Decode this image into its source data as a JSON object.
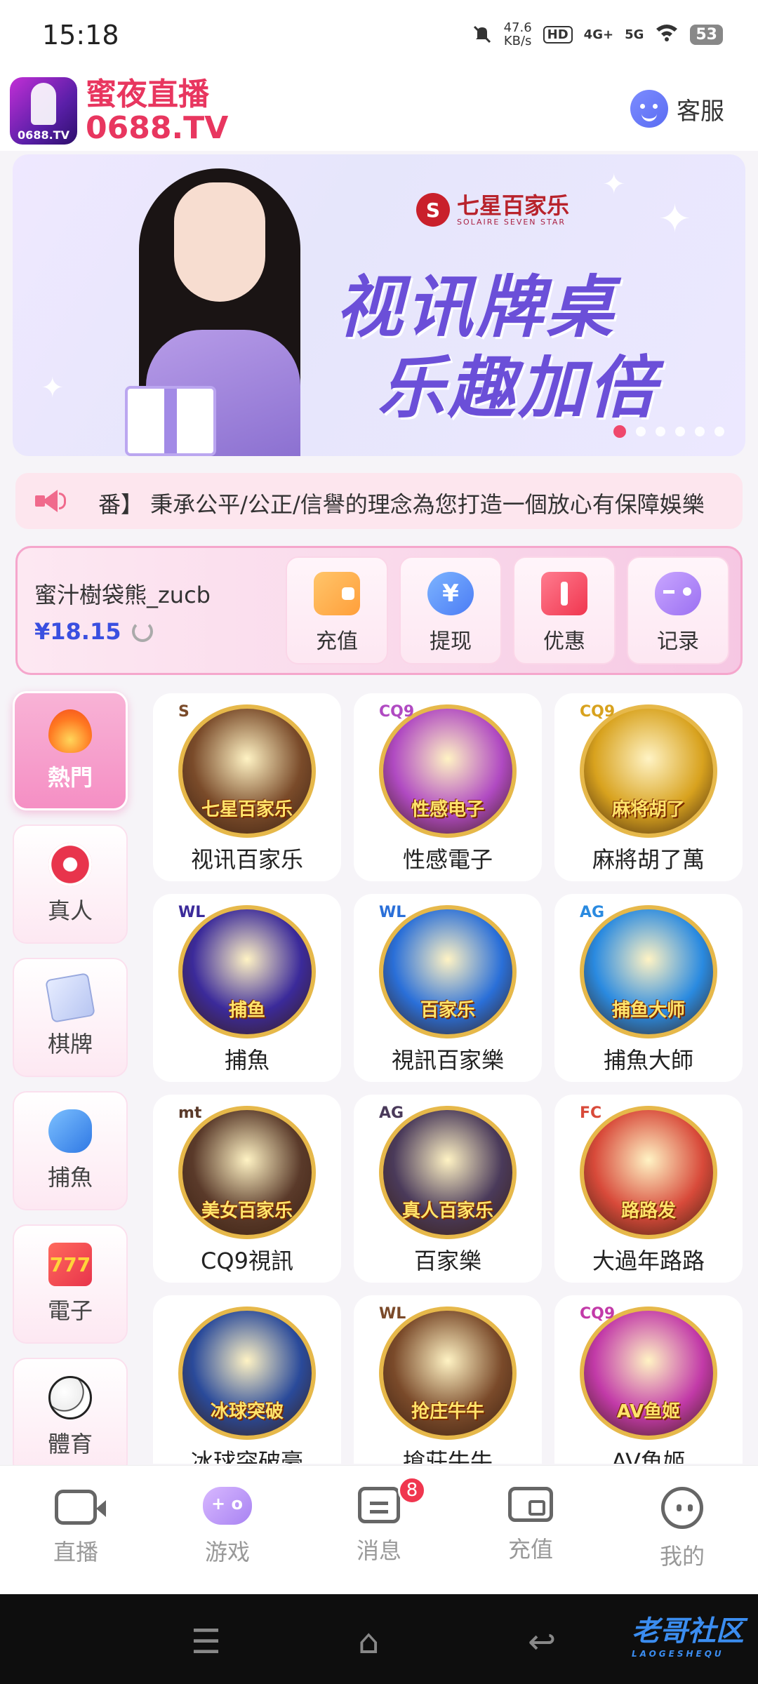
{
  "status": {
    "time": "15:18",
    "speed_value": "47.6",
    "speed_unit": "KB/s",
    "hd": "HD",
    "net1": "4G+",
    "net2": "5G",
    "battery": "53"
  },
  "header": {
    "logo_tag": "0688.TV",
    "title": "蜜夜直播",
    "url": "0688.TV",
    "customer_service": "客服"
  },
  "banner": {
    "brand_badge": "S",
    "brand_name": "七星百家乐",
    "brand_sub": "SOLAIRE SEVEN STAR",
    "line1": "视讯牌桌",
    "line2": "乐趣加倍",
    "slide_count": 6,
    "active_slide": 1
  },
  "marquee": {
    "text": "番】 秉承公平/公正/信譽的理念為您打造一個放心有保障娛樂"
  },
  "account": {
    "username": "蜜汁樹袋熊_zucb",
    "balance": "¥18.15",
    "actions": [
      {
        "label": "充值",
        "icon": "wallet-icon"
      },
      {
        "label": "提现",
        "icon": "yen-coin-icon"
      },
      {
        "label": "优惠",
        "icon": "ticket-icon"
      },
      {
        "label": "记录",
        "icon": "gamepad-icon"
      }
    ]
  },
  "categories": [
    {
      "label": "熱門",
      "icon": "fire-icon",
      "active": true
    },
    {
      "label": "真人",
      "icon": "chip-icon",
      "active": false
    },
    {
      "label": "棋牌",
      "icon": "cards-icon",
      "active": false
    },
    {
      "label": "捕魚",
      "icon": "shark-icon",
      "active": false
    },
    {
      "label": "電子",
      "icon": "slot-777-icon",
      "active": false
    },
    {
      "label": "體育",
      "icon": "soccer-ball-icon",
      "active": false
    }
  ],
  "games": [
    {
      "name": "视讯百家乐",
      "art_title": "七星百家乐",
      "provider": "S",
      "color": "#7a4b2a"
    },
    {
      "name": "性感電子",
      "art_title": "性感电子",
      "provider": "CQ9",
      "color": "#b04ac2"
    },
    {
      "name": "麻將胡了萬",
      "art_title": "麻将胡了",
      "provider": "CQ9",
      "color": "#d8a21e"
    },
    {
      "name": "捕魚",
      "art_title": "捕鱼",
      "provider": "WL",
      "color": "#3b2a9a"
    },
    {
      "name": "視訊百家樂",
      "art_title": "百家乐",
      "provider": "WL",
      "color": "#2a6fd8"
    },
    {
      "name": "捕魚大師",
      "art_title": "捕鱼大师",
      "provider": "AG",
      "color": "#2a8ae0"
    },
    {
      "name": "CQ9視訊",
      "art_title": "美女百家乐",
      "provider": "mt",
      "color": "#5a3a2a"
    },
    {
      "name": "百家樂",
      "art_title": "真人百家乐",
      "provider": "AG",
      "color": "#4a3a5a"
    },
    {
      "name": "大過年路路",
      "art_title": "路路发",
      "provider": "FC",
      "color": "#d84a3a"
    },
    {
      "name": "冰球突破豪",
      "art_title": "冰球突破",
      "provider": "",
      "color": "#2a4a9a"
    },
    {
      "name": "搶莊牛牛",
      "art_title": "抢庄牛牛",
      "provider": "WL",
      "color": "#7a4a2a"
    },
    {
      "name": "AV魚姬",
      "art_title": "AV鱼姬",
      "provider": "CQ9",
      "color": "#c23aa8"
    }
  ],
  "bottom_nav": [
    {
      "label": "直播",
      "icon": "tv-icon"
    },
    {
      "label": "游戏",
      "icon": "gamepad-icon"
    },
    {
      "label": "消息",
      "icon": "message-icon",
      "badge": "8"
    },
    {
      "label": "充值",
      "icon": "wallet-icon"
    },
    {
      "label": "我的",
      "icon": "face-icon"
    }
  ],
  "watermark": {
    "text": "老哥社区",
    "sub": "LAOGESHEQU"
  }
}
